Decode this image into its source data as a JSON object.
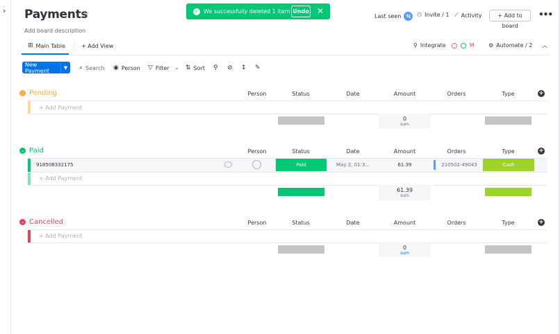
{
  "board": {
    "title": "Payments",
    "description": "Add board description"
  },
  "toast": {
    "message": "We successfully deleted 1 item",
    "undo_label": "Undo"
  },
  "header": {
    "last_seen": "Last seen",
    "last_seen_initials": "SJ",
    "invite": "Invite / 1",
    "activity": "Activity",
    "add_to_board": "+ Add to board"
  },
  "tabs": {
    "main_table": "Main Table",
    "add_view": "+ Add View",
    "integrate": "Integrate",
    "automate": "Automate / 2"
  },
  "toolbar": {
    "new_payment": "New Payment",
    "search_placeholder": "Search",
    "person": "Person",
    "filter": "Filter",
    "sort": "Sort"
  },
  "columns": [
    "Person",
    "Status",
    "Date",
    "Amount",
    "Orders",
    "Type"
  ],
  "groups": [
    {
      "name": "Pending",
      "color": "#fdab3d",
      "add_label": "+ Add Payment",
      "sum_value": "0",
      "sum_label": "sum"
    },
    {
      "name": "Paid",
      "color": "#00c875",
      "add_label": "+ Add Payment",
      "row": {
        "name": "918508332175",
        "status": "Paid",
        "date": "May 2, 01:3...",
        "amount": "61.39",
        "orders": "210502-49043",
        "type": "Cash"
      },
      "sum_value": "61.39",
      "sum_label": "sum"
    },
    {
      "name": "Cancelled",
      "color": "#e2445c",
      "add_label": "+ Add Payment",
      "sum_value": "0",
      "sum_label": "sum"
    }
  ],
  "colors": {
    "accent": "#0073ea",
    "status_paid": "#00c875",
    "type_cash": "#9cd326",
    "orders_bar": "#579bfc"
  }
}
